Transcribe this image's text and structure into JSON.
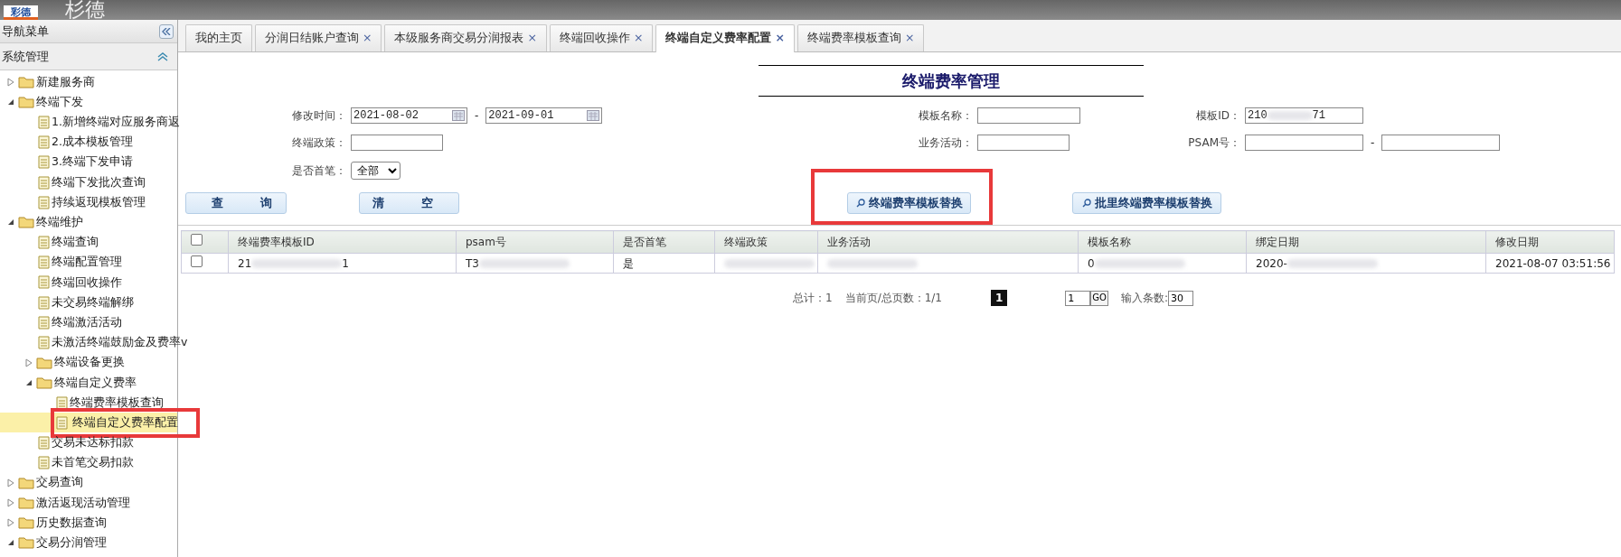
{
  "header": {
    "logo": "彩德",
    "title": "杉德"
  },
  "sidebar": {
    "title": "导航菜单",
    "section": "系统管理",
    "tree": [
      {
        "label": "新建服务商",
        "kind": "folder",
        "expanded": false
      },
      {
        "label": "终端下发",
        "kind": "folder",
        "expanded": true,
        "children": [
          {
            "label": "1.新增终端对应服务商返",
            "kind": "page",
            "selected": false,
            "highlighted": false
          },
          {
            "label": "2.成本模板管理",
            "kind": "page",
            "selected": false,
            "highlighted": false
          },
          {
            "label": "3.终端下发申请",
            "kind": "page",
            "selected": false,
            "highlighted": false
          },
          {
            "label": "终端下发批次查询",
            "kind": "page",
            "selected": false,
            "highlighted": false
          },
          {
            "label": "持续返现模板管理",
            "kind": "page",
            "selected": false,
            "highlighted": false
          }
        ]
      },
      {
        "label": "终端维护",
        "kind": "folder",
        "expanded": true,
        "children": [
          {
            "label": "终端查询",
            "kind": "page",
            "selected": false,
            "highlighted": false
          },
          {
            "label": "终端配置管理",
            "kind": "page",
            "selected": false,
            "highlighted": false
          },
          {
            "label": "终端回收操作",
            "kind": "page",
            "selected": false,
            "highlighted": false
          },
          {
            "label": "未交易终端解绑",
            "kind": "page",
            "selected": false,
            "highlighted": false
          },
          {
            "label": "终端激活活动",
            "kind": "page",
            "selected": false,
            "highlighted": false
          },
          {
            "label": "未激活终端鼓励金及费率v",
            "kind": "page",
            "selected": false,
            "highlighted": false
          },
          {
            "label": "终端设备更换",
            "kind": "folder",
            "expanded": false
          },
          {
            "label": "终端自定义费率",
            "kind": "folder",
            "expanded": true,
            "children": [
              {
                "label": "终端费率模板查询",
                "kind": "page",
                "selected": false,
                "highlighted": false
              },
              {
                "label": "终端自定义费率配置",
                "kind": "page",
                "selected": true,
                "highlighted": true
              }
            ]
          },
          {
            "label": "交易未达标扣款",
            "kind": "page",
            "selected": false,
            "highlighted": false
          },
          {
            "label": "未首笔交易扣款",
            "kind": "page",
            "selected": false,
            "highlighted": false
          }
        ]
      },
      {
        "label": "交易查询",
        "kind": "folder",
        "expanded": false
      },
      {
        "label": "激活返现活动管理",
        "kind": "folder",
        "expanded": false
      },
      {
        "label": "历史数据查询",
        "kind": "folder",
        "expanded": false
      },
      {
        "label": "交易分润管理",
        "kind": "folder",
        "expanded": true
      }
    ]
  },
  "tabs": [
    {
      "label": "我的主页",
      "selected": false
    },
    {
      "label": "分润日结账户查询",
      "selected": false,
      "close": "×"
    },
    {
      "label": "本级服务商交易分润报表",
      "selected": false,
      "close": "×"
    },
    {
      "label": "终端回收操作",
      "selected": false,
      "close": "×"
    },
    {
      "label": "终端自定义费率配置",
      "selected": true,
      "close": "×"
    },
    {
      "label": "终端费率模板查询",
      "selected": false,
      "close": "×"
    }
  ],
  "page_title": "终端费率管理",
  "filters": {
    "modify_time": {
      "label": "修改时间：",
      "from": "2021-08-02",
      "to": "2021-09-01",
      "separator": "-"
    },
    "template_name": {
      "label": "模板名称："
    },
    "template_id": {
      "label": "模板ID：",
      "value": "210",
      "value_tail": "71"
    },
    "policy": {
      "label": "终端政策："
    },
    "activity": {
      "label": "业务活动："
    },
    "psam": {
      "label": "PSAM号：",
      "separator": "-"
    },
    "first": {
      "label": "是否首笔：",
      "value": "全部"
    }
  },
  "buttons": [
    {
      "label": "查　询",
      "kind": "search",
      "highlighted": false
    },
    {
      "label": "清　空",
      "kind": "plain",
      "highlighted": false
    },
    {
      "label": "终端费率模板替换",
      "kind": "search",
      "highlighted": true
    },
    {
      "label": "批里终端费率模板替换",
      "kind": "search",
      "highlighted": false
    }
  ],
  "table": {
    "all_checked": false,
    "columns": [
      "终端费率模板ID",
      "psam号",
      "是否首笔",
      "终端政策",
      "业务活动",
      "模板名称",
      "绑定日期",
      "修改日期"
    ],
    "rows": [
      {
        "selected": false,
        "cells": [
          {
            "text": "21",
            "blurred": true,
            "tail": "1"
          },
          {
            "text": "T3",
            "blurred": true
          },
          {
            "text": "是",
            "blurred": false
          },
          {
            "blurred": true
          },
          {
            "blurred": true
          },
          {
            "text": "0",
            "blurred": true
          },
          {
            "text": "2020-",
            "blurred": true
          },
          {
            "text": "2021-08-07 03:51:56",
            "blurred": false
          }
        ]
      }
    ]
  },
  "pagination": {
    "total": "总计：1",
    "pages": "当前页/总页数：1/1",
    "current": "1",
    "goto": "1",
    "go": "GO",
    "size_label": "输入条数:",
    "size": "30"
  }
}
